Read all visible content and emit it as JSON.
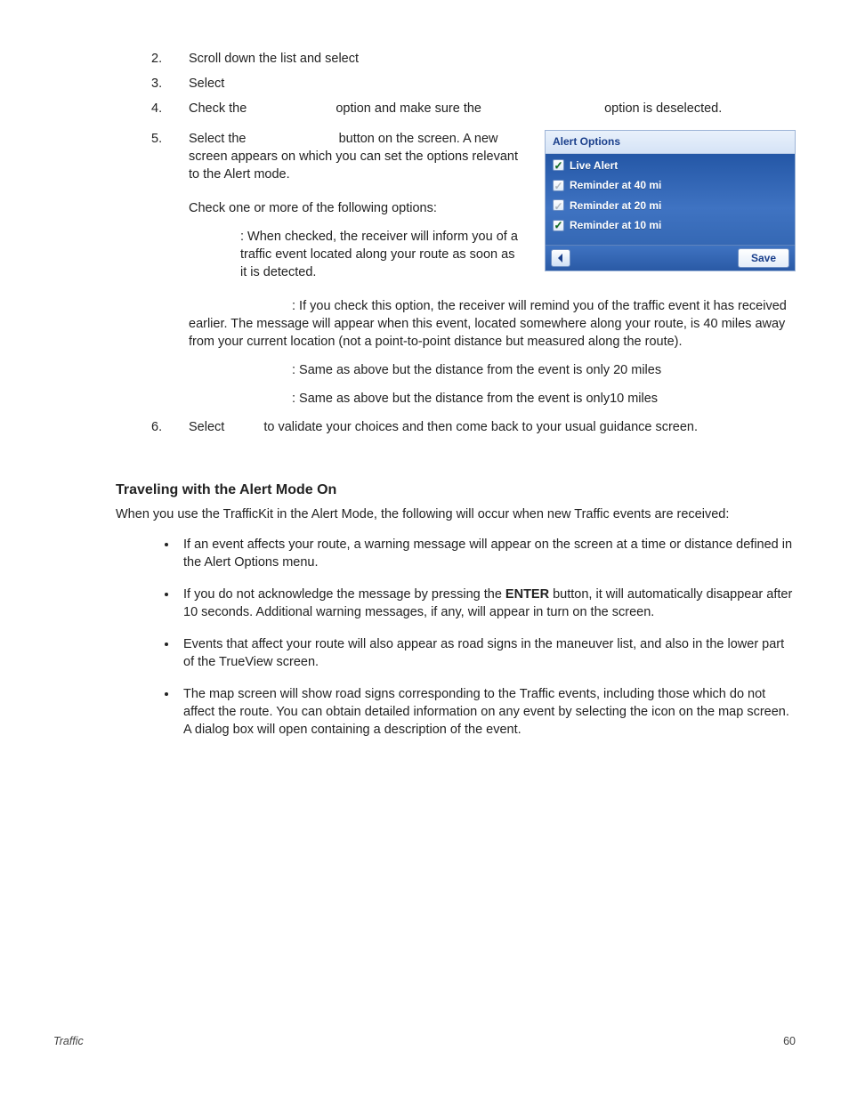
{
  "steps": {
    "s2": {
      "num": "2.",
      "text": "Scroll down the list and select"
    },
    "s3": {
      "num": "3.",
      "text": "Select"
    },
    "s4": {
      "num": "4.",
      "a": "Check the",
      "b": "option and make sure the",
      "c": "option is deselected."
    },
    "s5": {
      "num": "5.",
      "p1a": "Select the",
      "p1b": "button on the screen. A new screen appears on which you can set the options relevant to the Alert mode.",
      "p2": "Check one or more of the following options:",
      "d1": ": When checked, the receiver will inform you of a traffic event located along your route as soon as it is detected.",
      "d2": ": If you check this option, the receiver will remind you of the traffic event it has received earlier. The message will appear when this event, located somewhere along your route, is 40 miles away from your current location (not a point-to-point distance but measured along the route).",
      "d3": ": Same as above but the distance from the event is only 20 miles",
      "d4": ": Same as above but the distance from the event is only10 miles"
    },
    "s6": {
      "num": "6.",
      "a": "Select",
      "b": "to validate your choices and then come back to your usual guidance screen."
    }
  },
  "device": {
    "title": "Alert Options",
    "rows": [
      {
        "label": "Live Alert",
        "checked": true
      },
      {
        "label": "Reminder at 40 mi",
        "checked": false
      },
      {
        "label": "Reminder at 20 mi",
        "checked": false
      },
      {
        "label": "Reminder at 10 mi",
        "checked": true
      }
    ],
    "save": "Save"
  },
  "subhead": "Traveling with the Alert Mode On",
  "intro": "When you use the TrafficKit in the Alert Mode, the following will occur when new Traffic events are received:",
  "bullets": {
    "b1": "If an event affects your route, a warning message will appear on the screen at a time or distance defined in the Alert Options menu.",
    "b2a": "If you do not acknowledge the message by pressing the ",
    "b2key": "ENTER",
    "b2b": " button, it will automatically disappear after 10 seconds. Additional warning messages, if any, will appear in turn on the screen.",
    "b3": "Events that affect your route will also appear as road signs in the maneuver list, and also in the lower part of the TrueView screen.",
    "b4": "The map screen will show road signs corresponding to the Traffic events, including those which do not affect the route. You can obtain detailed information on any event by selecting the icon on the map screen. A dialog box will open containing a description of the event."
  },
  "footer": {
    "section": "Traffic",
    "page": "60"
  }
}
